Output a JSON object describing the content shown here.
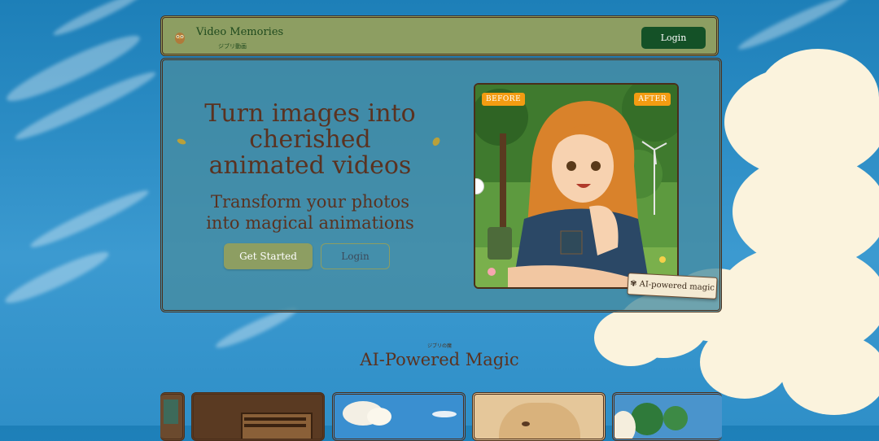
{
  "header": {
    "title": "Video Memories",
    "subtitle": "ジブリ動画",
    "login_label": "Login",
    "logo_icon": "owl-icon"
  },
  "hero": {
    "title": "Turn images into cherished animated videos",
    "subtitle": "Transform your photos into magical animations",
    "primary_button": "Get Started",
    "secondary_button": "Login",
    "compare": {
      "before_label": "BEFORE",
      "after_label": "AFTER"
    },
    "ai_tag": "AI-powered magic",
    "ai_tag_icon": "sparkle-icon"
  },
  "section": {
    "kicker": "ジブリの魔",
    "title": "AI-Powered Magic"
  },
  "colors": {
    "header_bg": "#8d9e62",
    "login_bg": "#145127",
    "badge": "#f39c12",
    "heading_text": "#5a3220"
  }
}
